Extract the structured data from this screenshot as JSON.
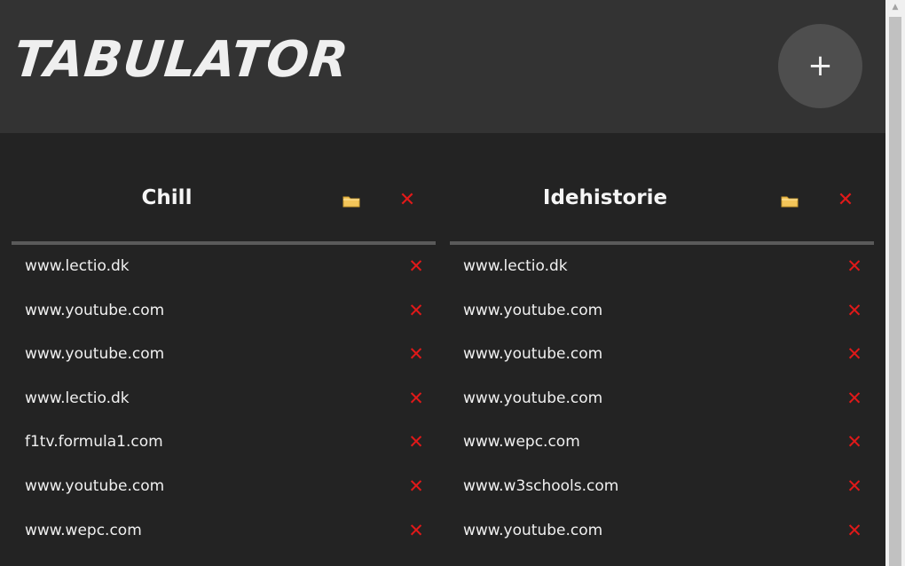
{
  "header": {
    "logo": "TABULATOR",
    "add_button": "+"
  },
  "groups": [
    {
      "title": "Chill",
      "folder_icon": "folder-icon",
      "delete_icon": "✕",
      "links": [
        "www.lectio.dk",
        "www.youtube.com",
        "www.youtube.com",
        "www.lectio.dk",
        "f1tv.formula1.com",
        "www.youtube.com",
        "www.wepc.com"
      ]
    },
    {
      "title": "Idehistorie",
      "folder_icon": "folder-icon",
      "delete_icon": "✕",
      "links": [
        "www.lectio.dk",
        "www.youtube.com",
        "www.youtube.com",
        "www.youtube.com",
        "www.wepc.com",
        "www.w3schools.com",
        "www.youtube.com"
      ]
    }
  ],
  "icons": {
    "delete": "close-icon",
    "folder": "folder-icon",
    "scroll_up": "▲"
  },
  "colors": {
    "background": "#232323",
    "header": "#333333",
    "add_button": "#4e4e4e",
    "delete_red": "#e01919",
    "folder_yellow": "#f3c55a",
    "divider": "#5a5a5a"
  }
}
